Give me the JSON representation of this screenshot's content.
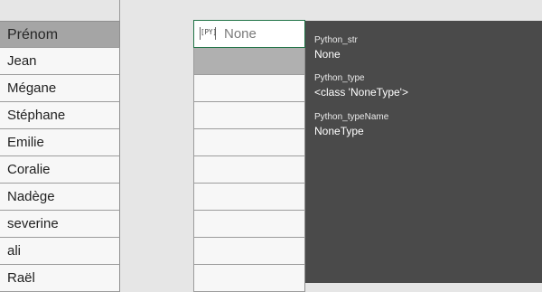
{
  "column_a": {
    "header": "Prénom",
    "rows": [
      "Jean",
      "Mégane",
      "Stéphane",
      "Emilie",
      "Coralie",
      "Nadège",
      "severine",
      "ali",
      "Raël"
    ]
  },
  "active_cell": {
    "badge": "[PY]",
    "value": "None"
  },
  "card": {
    "fields": [
      {
        "label": "Python_str",
        "value": "None"
      },
      {
        "label": "Python_type",
        "value": "<class 'NoneType'>"
      },
      {
        "label": "Python_typeName",
        "value": "NoneType"
      }
    ]
  },
  "colors": {
    "header_fill": "#a5a5a5",
    "card_background": "#4a4a4a",
    "active_border": "#217346"
  }
}
